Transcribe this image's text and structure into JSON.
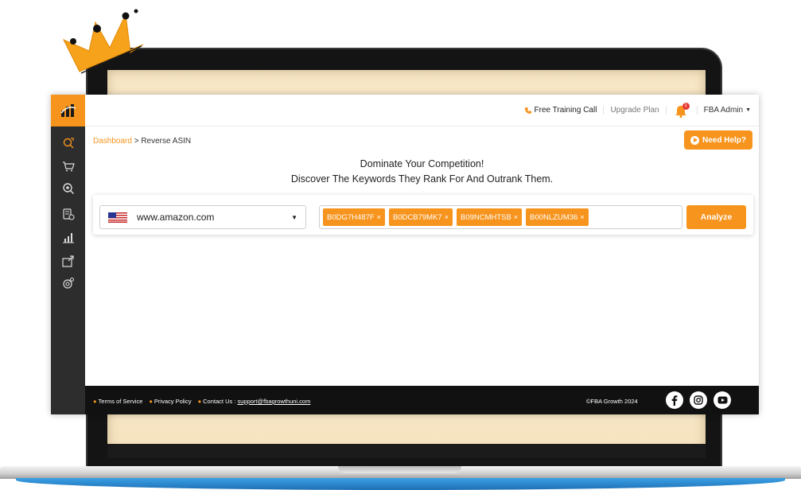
{
  "topbar": {
    "training_label": "Free Training Call",
    "upgrade_label": "Upgrade Plan",
    "notification_count": "1",
    "admin_label": "FBA Admin"
  },
  "breadcrumb": {
    "root": "Dashboard",
    "separator": ">",
    "current": "Reverse ASIN"
  },
  "help_button": {
    "label": "Need Help?"
  },
  "headline": {
    "line1": "Dominate Your Competition!",
    "line2": "Discover The Keywords They Rank For And Outrank Them."
  },
  "search": {
    "marketplace": "www.amazon.com",
    "asins": [
      "B0DG7H487F",
      "B0DCB79MK7",
      "B09NCMHTSB",
      "B00NLZUM36"
    ],
    "remove_glyph": "×",
    "analyze_label": "Analyze"
  },
  "sidebar": {
    "items": [
      {
        "icon": "reverse-asin-icon",
        "active": true
      },
      {
        "icon": "cart-icon"
      },
      {
        "icon": "keyword-search-icon"
      },
      {
        "icon": "listing-icon"
      },
      {
        "icon": "rank-chart-icon"
      },
      {
        "icon": "launch-icon"
      },
      {
        "icon": "settings-icon"
      }
    ]
  },
  "footer": {
    "terms": "Terms of Service",
    "privacy": "Privacy Policy",
    "contact_label": "Contact Us :",
    "email": "support@fbagrowthuni.com",
    "copyright": "©FBA Growth 2024"
  },
  "colors": {
    "accent": "#f7941d",
    "sidebar": "#2d2d2d",
    "footer": "#111111",
    "badge": "#e53935"
  }
}
